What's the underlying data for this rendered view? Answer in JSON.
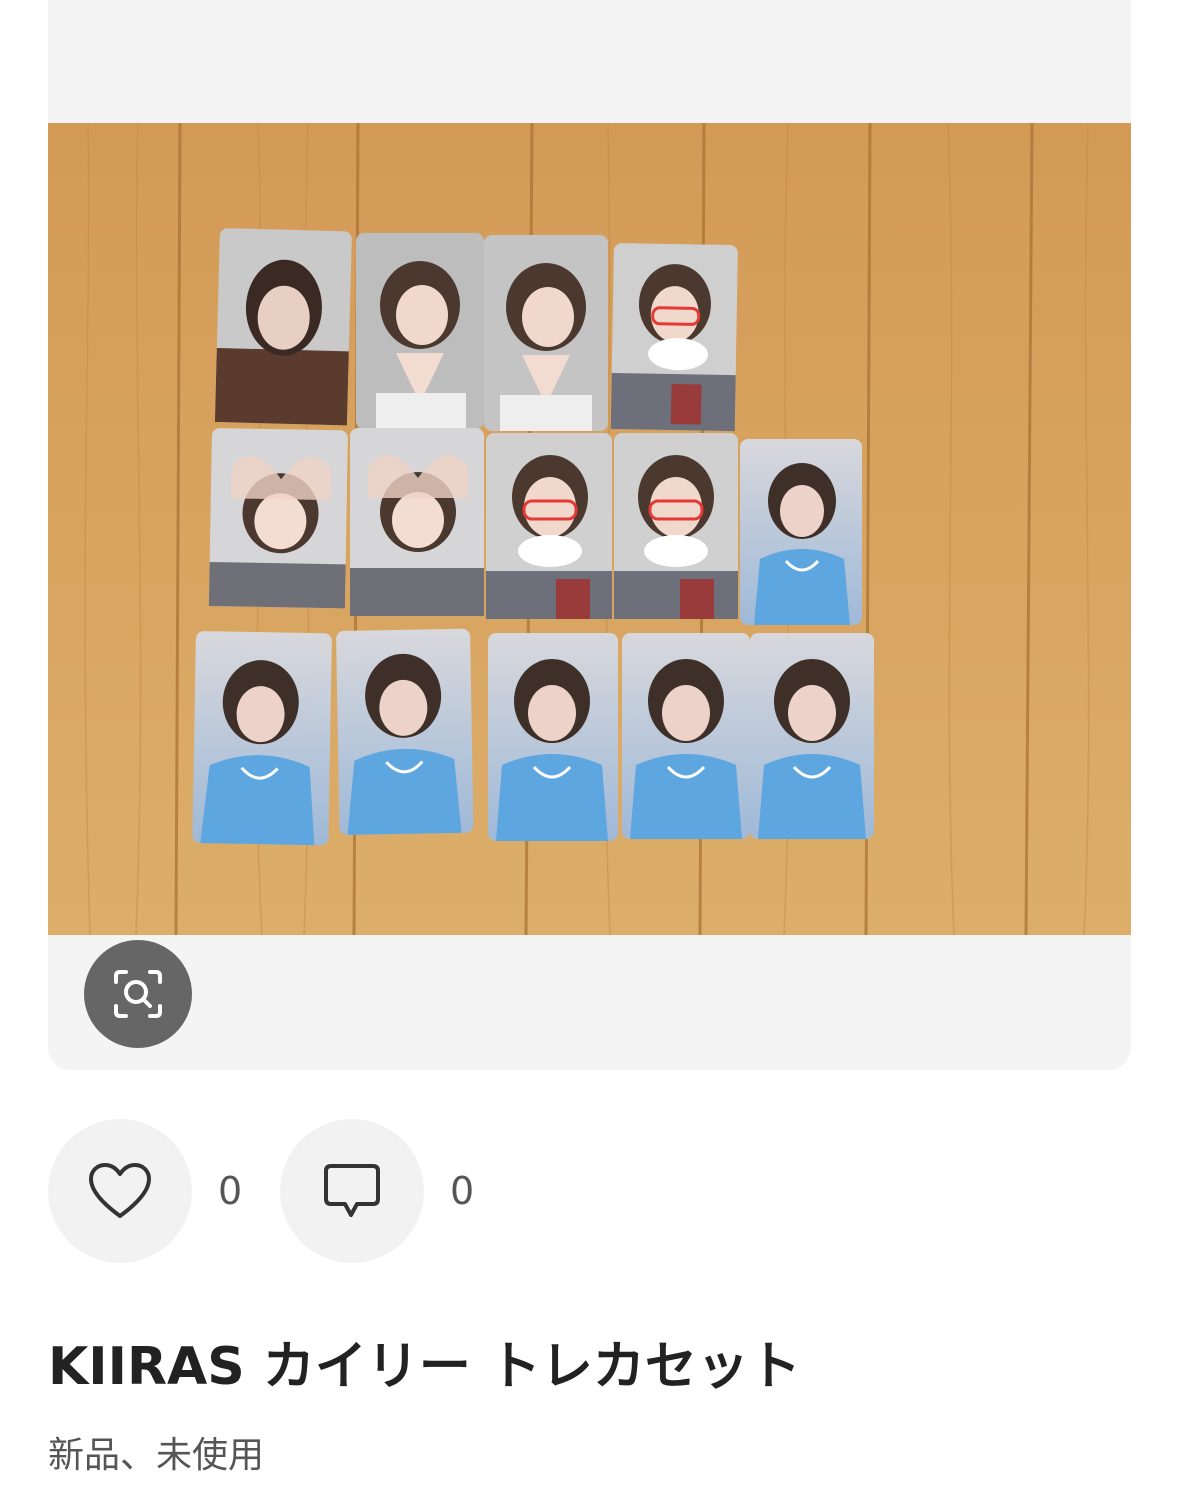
{
  "product": {
    "title": "KIIRAS カイリー トレカセット",
    "condition": "新品、未使用"
  },
  "image": {
    "lens_icon": "visual-search-icon",
    "photo_description_icon": "product-photo"
  },
  "actions": {
    "like": {
      "icon": "heart-icon",
      "count": "0"
    },
    "comment": {
      "icon": "comment-icon",
      "count": "0"
    }
  },
  "colors": {
    "wood": "#d6a15c",
    "lens_button": "#666666",
    "action_bg": "#f2f2f2"
  }
}
